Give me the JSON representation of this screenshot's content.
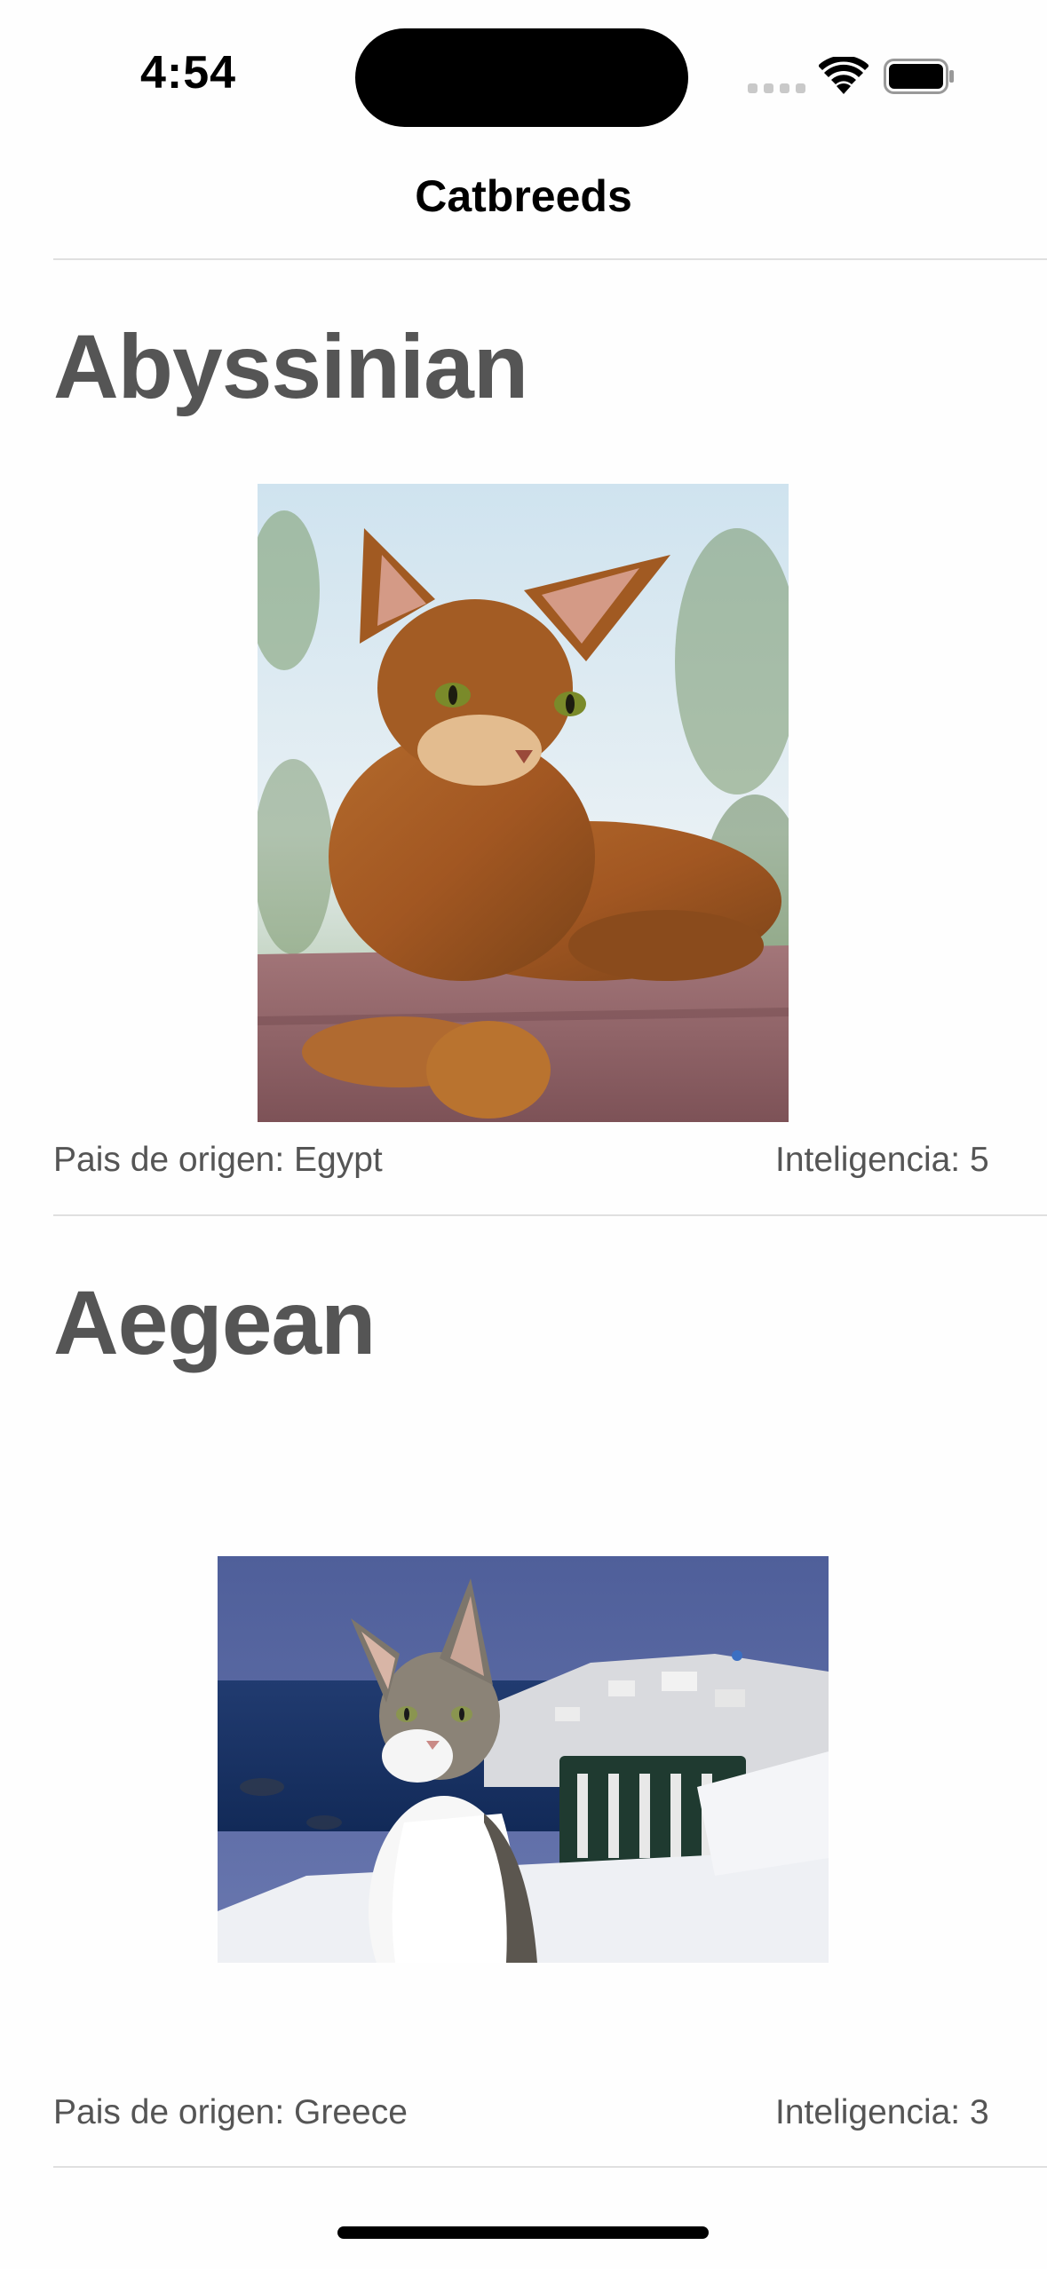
{
  "status_bar": {
    "time": "4:54",
    "icons": [
      "cellular-signal-icon",
      "wifi-icon",
      "battery-icon"
    ]
  },
  "nav": {
    "title": "Catbreeds"
  },
  "breeds": [
    {
      "name": "Abyssinian",
      "image": "abyssinian-cat-photo",
      "origin_label": "Pais de origen: Egypt",
      "intelligence_label": "Inteligencia: 5"
    },
    {
      "name": "Aegean",
      "image": "aegean-cat-photo",
      "origin_label": "Pais de origen: Greece",
      "intelligence_label": "Inteligencia: 3"
    }
  ],
  "colors": {
    "text_primary": "#000000",
    "text_secondary": "#555555",
    "divider": "#e0e0e0",
    "background": "#fefefe"
  }
}
